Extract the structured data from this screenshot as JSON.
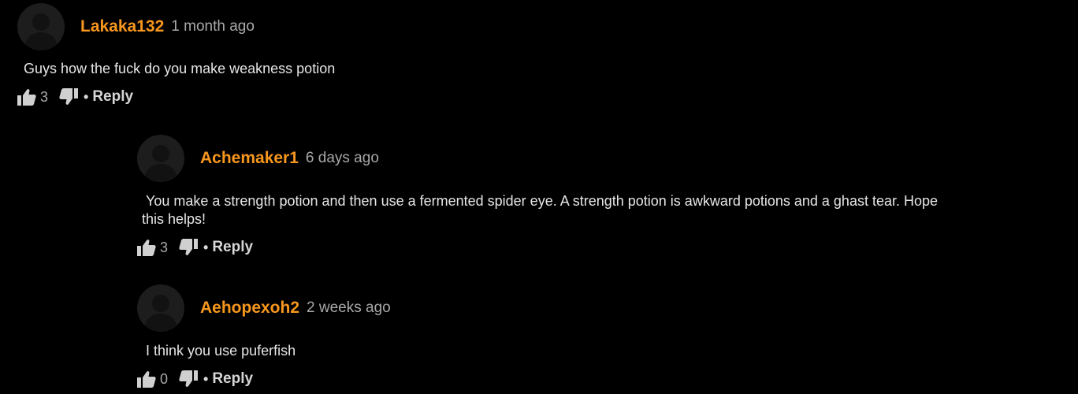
{
  "comments": [
    {
      "username": "Lakaka132",
      "time": "1 month ago",
      "text": "Guys how the fuck do you make weakness potion",
      "likes": "3",
      "reply_label": "Reply",
      "separator": "•"
    },
    {
      "username": "Achemaker1",
      "time": "6 days ago",
      "text": " You make a strength potion and then use a fermented spider eye. A strength potion is awkward potions and a ghast tear. Hope\nthis helps!",
      "likes": "3",
      "reply_label": "Reply",
      "separator": "•"
    },
    {
      "username": "Aehopexoh2",
      "time": "2 weeks ago",
      "text": " I think you use puferfish",
      "likes": "0",
      "reply_label": "Reply",
      "separator": "•"
    }
  ],
  "colors": {
    "background": "#000000",
    "username": "#f7971e",
    "timestamp": "#a8a8a8",
    "text": "#e6e6e6",
    "avatar": "#1d1d1d"
  },
  "icons": {
    "avatar": "user-silhouette-icon",
    "like": "thumbs-up-icon",
    "dislike": "thumbs-down-icon"
  }
}
